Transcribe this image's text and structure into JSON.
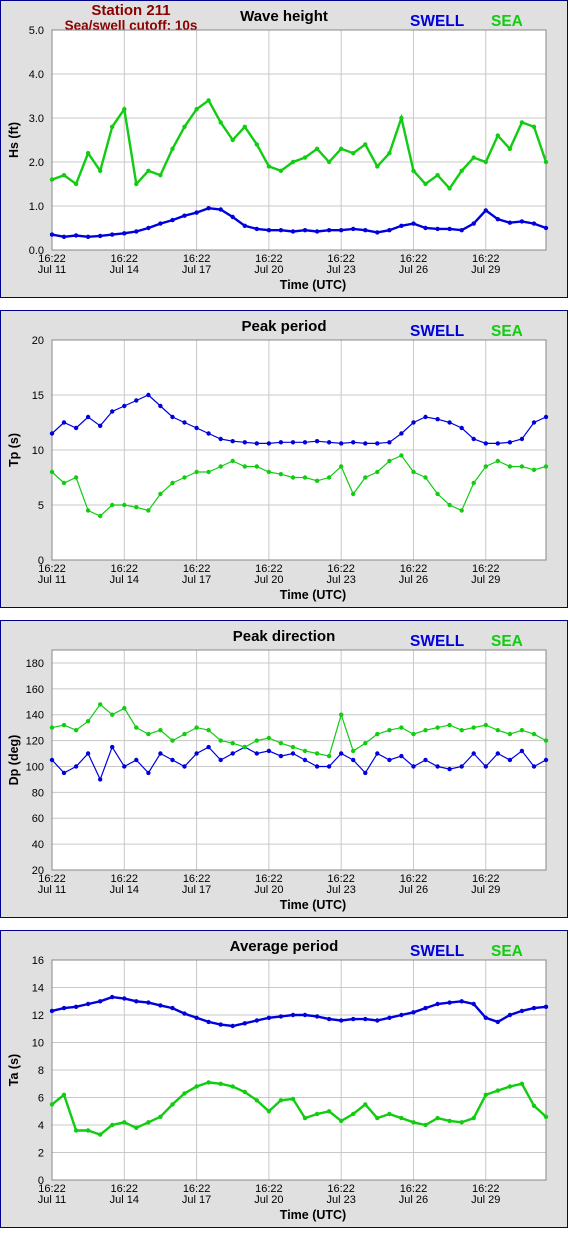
{
  "header": {
    "station": "Station 211",
    "cutoff": "Sea/swell cutoff: 10s"
  },
  "colors": {
    "swell": "#0000dd",
    "sea": "#11cc11",
    "title": "#8b0000",
    "frame": "#00008b"
  },
  "legend": {
    "swell": "SWELL",
    "sea": "SEA"
  },
  "x_axis": {
    "label": "Time (UTC)",
    "ticks": [
      {
        "time": "16:22",
        "date": "Jul 11"
      },
      {
        "time": "16:22",
        "date": "Jul 14"
      },
      {
        "time": "16:22",
        "date": "Jul 17"
      },
      {
        "time": "16:22",
        "date": "Jul 20"
      },
      {
        "time": "16:22",
        "date": "Jul 23"
      },
      {
        "time": "16:22",
        "date": "Jul 26"
      },
      {
        "time": "16:22",
        "date": "Jul 29"
      }
    ],
    "range_days": [
      0,
      20.5
    ]
  },
  "chart_data": [
    {
      "type": "line",
      "title": "Wave height",
      "ylabel": "Hs (ft)",
      "ylim": [
        0,
        5
      ],
      "yticks": [
        "0.0",
        "1.0",
        "2.0",
        "3.0",
        "4.0",
        "5.0"
      ],
      "grid": true,
      "x_units": "days since Jul 11 16:22",
      "series": [
        {
          "name": "SWELL",
          "x": [
            0,
            0.5,
            1,
            1.5,
            2,
            2.5,
            3,
            3.5,
            4,
            4.5,
            5,
            5.5,
            6,
            6.5,
            7,
            7.5,
            8,
            8.5,
            9,
            9.5,
            10,
            10.5,
            11,
            11.5,
            12,
            12.5,
            13,
            13.5,
            14,
            14.5,
            15,
            15.5,
            16,
            16.5,
            17,
            17.5,
            18,
            18.5,
            19,
            19.5,
            20,
            20.5
          ],
          "values": [
            0.35,
            0.3,
            0.33,
            0.3,
            0.32,
            0.35,
            0.38,
            0.42,
            0.5,
            0.6,
            0.68,
            0.78,
            0.85,
            0.95,
            0.92,
            0.75,
            0.55,
            0.48,
            0.45,
            0.45,
            0.42,
            0.45,
            0.42,
            0.45,
            0.45,
            0.48,
            0.45,
            0.4,
            0.45,
            0.55,
            0.6,
            0.5,
            0.48,
            0.48,
            0.45,
            0.6,
            0.9,
            0.7,
            0.62,
            0.65,
            0.6,
            0.5
          ]
        },
        {
          "name": "SEA",
          "x": [
            0,
            0.5,
            1,
            1.5,
            2,
            2.5,
            3,
            3.5,
            4,
            4.5,
            5,
            5.5,
            6,
            6.5,
            7,
            7.5,
            8,
            8.5,
            9,
            9.5,
            10,
            10.5,
            11,
            11.5,
            12,
            12.5,
            13,
            13.5,
            14,
            14.5,
            15,
            15.5,
            16,
            16.5,
            17,
            17.5,
            18,
            18.5,
            19,
            19.5,
            20,
            20.5
          ],
          "values": [
            1.6,
            1.7,
            1.5,
            2.2,
            1.8,
            2.8,
            3.2,
            1.5,
            1.8,
            1.7,
            2.3,
            2.8,
            3.2,
            3.4,
            2.9,
            2.5,
            2.8,
            2.4,
            1.9,
            1.8,
            2.0,
            2.1,
            2.3,
            2.0,
            2.3,
            2.2,
            2.4,
            1.9,
            2.2,
            3.0,
            1.8,
            1.5,
            1.7,
            1.4,
            1.8,
            2.1,
            2.0,
            2.6,
            2.3,
            2.9,
            2.8,
            2.0
          ]
        }
      ]
    },
    {
      "type": "scatter",
      "title": "Peak period",
      "ylabel": "Tp (s)",
      "ylim": [
        0,
        20
      ],
      "yticks": [
        "0",
        "5",
        "10",
        "15",
        "20"
      ],
      "grid": true,
      "x_units": "days since Jul 11 16:22",
      "series": [
        {
          "name": "SWELL",
          "x": [
            0,
            0.5,
            1,
            1.5,
            2,
            2.5,
            3,
            3.5,
            4,
            4.5,
            5,
            5.5,
            6,
            6.5,
            7,
            7.5,
            8,
            8.5,
            9,
            9.5,
            10,
            10.5,
            11,
            11.5,
            12,
            12.5,
            13,
            13.5,
            14,
            14.5,
            15,
            15.5,
            16,
            16.5,
            17,
            17.5,
            18,
            18.5,
            19,
            19.5,
            20,
            20.5
          ],
          "values": [
            11.5,
            12.5,
            12,
            13,
            12.2,
            13.5,
            14,
            14.5,
            15,
            14,
            13,
            12.5,
            12,
            11.5,
            11,
            10.8,
            10.7,
            10.6,
            10.6,
            10.7,
            10.7,
            10.7,
            10.8,
            10.7,
            10.6,
            10.7,
            10.6,
            10.6,
            10.7,
            11.5,
            12.5,
            13,
            12.8,
            12.5,
            12,
            11,
            10.6,
            10.6,
            10.7,
            11,
            12.5,
            13
          ]
        },
        {
          "name": "SEA",
          "x": [
            0,
            0.5,
            1,
            1.5,
            2,
            2.5,
            3,
            3.5,
            4,
            4.5,
            5,
            5.5,
            6,
            6.5,
            7,
            7.5,
            8,
            8.5,
            9,
            9.5,
            10,
            10.5,
            11,
            11.5,
            12,
            12.5,
            13,
            13.5,
            14,
            14.5,
            15,
            15.5,
            16,
            16.5,
            17,
            17.5,
            18,
            18.5,
            19,
            19.5,
            20,
            20.5
          ],
          "values": [
            8,
            7,
            7.5,
            4.5,
            4,
            5,
            5,
            4.8,
            4.5,
            6,
            7,
            7.5,
            8,
            8,
            8.5,
            9,
            8.5,
            8.5,
            8,
            7.8,
            7.5,
            7.5,
            7.2,
            7.5,
            8.5,
            6,
            7.5,
            8,
            9,
            9.5,
            8,
            7.5,
            6,
            5,
            4.5,
            7,
            8.5,
            9,
            8.5,
            8.5,
            8.2,
            8.5
          ]
        }
      ]
    },
    {
      "type": "scatter",
      "title": "Peak direction",
      "ylabel": "Dp (deg)",
      "ylim": [
        20,
        190
      ],
      "yticks": [
        "20",
        "40",
        "60",
        "80",
        "100",
        "120",
        "140",
        "160",
        "180"
      ],
      "grid": true,
      "x_units": "days since Jul 11 16:22",
      "series": [
        {
          "name": "SWELL",
          "x": [
            0,
            0.5,
            1,
            1.5,
            2,
            2.5,
            3,
            3.5,
            4,
            4.5,
            5,
            5.5,
            6,
            6.5,
            7,
            7.5,
            8,
            8.5,
            9,
            9.5,
            10,
            10.5,
            11,
            11.5,
            12,
            12.5,
            13,
            13.5,
            14,
            14.5,
            15,
            15.5,
            16,
            16.5,
            17,
            17.5,
            18,
            18.5,
            19,
            19.5,
            20,
            20.5
          ],
          "values": [
            105,
            95,
            100,
            110,
            90,
            115,
            100,
            105,
            95,
            110,
            105,
            100,
            110,
            115,
            105,
            110,
            115,
            110,
            112,
            108,
            110,
            105,
            100,
            100,
            110,
            105,
            95,
            110,
            105,
            108,
            100,
            105,
            100,
            98,
            100,
            110,
            100,
            110,
            105,
            112,
            100,
            105
          ]
        },
        {
          "name": "SEA",
          "x": [
            0,
            0.5,
            1,
            1.5,
            2,
            2.5,
            3,
            3.5,
            4,
            4.5,
            5,
            5.5,
            6,
            6.5,
            7,
            7.5,
            8,
            8.5,
            9,
            9.5,
            10,
            10.5,
            11,
            11.5,
            12,
            12.5,
            13,
            13.5,
            14,
            14.5,
            15,
            15.5,
            16,
            16.5,
            17,
            17.5,
            18,
            18.5,
            19,
            19.5,
            20,
            20.5
          ],
          "values": [
            130,
            132,
            128,
            135,
            148,
            140,
            145,
            130,
            125,
            128,
            120,
            125,
            130,
            128,
            120,
            118,
            115,
            120,
            122,
            118,
            115,
            112,
            110,
            108,
            140,
            112,
            118,
            125,
            128,
            130,
            125,
            128,
            130,
            132,
            128,
            130,
            132,
            128,
            125,
            128,
            125,
            120
          ]
        }
      ]
    },
    {
      "type": "line",
      "title": "Average period",
      "ylabel": "Ta (s)",
      "ylim": [
        0,
        16
      ],
      "yticks": [
        "0",
        "2",
        "4",
        "6",
        "8",
        "10",
        "12",
        "14",
        "16"
      ],
      "grid": true,
      "x_units": "days since Jul 11 16:22",
      "series": [
        {
          "name": "SWELL",
          "x": [
            0,
            0.5,
            1,
            1.5,
            2,
            2.5,
            3,
            3.5,
            4,
            4.5,
            5,
            5.5,
            6,
            6.5,
            7,
            7.5,
            8,
            8.5,
            9,
            9.5,
            10,
            10.5,
            11,
            11.5,
            12,
            12.5,
            13,
            13.5,
            14,
            14.5,
            15,
            15.5,
            16,
            16.5,
            17,
            17.5,
            18,
            18.5,
            19,
            19.5,
            20,
            20.5
          ],
          "values": [
            12.3,
            12.5,
            12.6,
            12.8,
            13.0,
            13.3,
            13.2,
            13.0,
            12.9,
            12.7,
            12.5,
            12.1,
            11.8,
            11.5,
            11.3,
            11.2,
            11.4,
            11.6,
            11.8,
            11.9,
            12.0,
            12.0,
            11.9,
            11.7,
            11.6,
            11.7,
            11.7,
            11.6,
            11.8,
            12.0,
            12.2,
            12.5,
            12.8,
            12.9,
            13.0,
            12.8,
            11.8,
            11.5,
            12.0,
            12.3,
            12.5,
            12.6
          ]
        },
        {
          "name": "SEA",
          "x": [
            0,
            0.5,
            1,
            1.5,
            2,
            2.5,
            3,
            3.5,
            4,
            4.5,
            5,
            5.5,
            6,
            6.5,
            7,
            7.5,
            8,
            8.5,
            9,
            9.5,
            10,
            10.5,
            11,
            11.5,
            12,
            12.5,
            13,
            13.5,
            14,
            14.5,
            15,
            15.5,
            16,
            16.5,
            17,
            17.5,
            18,
            18.5,
            19,
            19.5,
            20,
            20.5
          ],
          "values": [
            5.5,
            6.2,
            3.6,
            3.6,
            3.3,
            4.0,
            4.2,
            3.8,
            4.2,
            4.6,
            5.5,
            6.3,
            6.8,
            7.1,
            7.0,
            6.8,
            6.4,
            5.8,
            5.0,
            5.8,
            5.9,
            4.5,
            4.8,
            5.0,
            4.3,
            4.8,
            5.5,
            4.5,
            4.8,
            4.5,
            4.2,
            4.0,
            4.5,
            4.3,
            4.2,
            4.5,
            6.2,
            6.5,
            6.8,
            7.0,
            5.4,
            4.6
          ]
        }
      ]
    }
  ]
}
